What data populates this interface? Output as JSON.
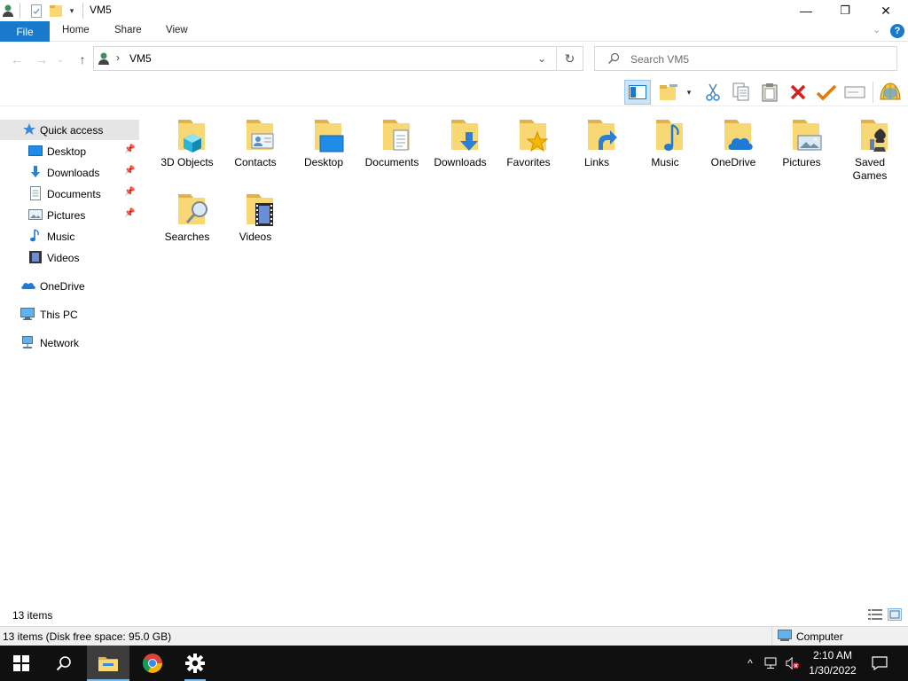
{
  "window": {
    "title": "VM5",
    "controls": {
      "minimize": "—",
      "maximize": "❐",
      "close": "✕"
    }
  },
  "ribbon": {
    "tabs": [
      {
        "label": "File"
      },
      {
        "label": "Home"
      },
      {
        "label": "Share"
      },
      {
        "label": "View"
      }
    ],
    "expand_icon": "chevron-down-icon",
    "help_label": "?"
  },
  "address": {
    "path_separator": "›",
    "location": "VM5",
    "search_placeholder": "Search VM5"
  },
  "toolbar": {
    "icons": [
      "navigation-pane-icon",
      "new-folder-icon",
      "cut-icon",
      "copy-icon",
      "paste-icon",
      "delete-icon",
      "check-icon",
      "rename-icon",
      "shell-icon"
    ]
  },
  "navigation": {
    "quick_access": {
      "label": "Quick access"
    },
    "pinned": [
      {
        "label": "Desktop",
        "icon": "desktop-icon",
        "pinned": true
      },
      {
        "label": "Downloads",
        "icon": "downloads-icon",
        "pinned": true
      },
      {
        "label": "Documents",
        "icon": "documents-icon",
        "pinned": true
      },
      {
        "label": "Pictures",
        "icon": "pictures-icon",
        "pinned": true
      },
      {
        "label": "Music",
        "icon": "music-icon",
        "pinned": false
      },
      {
        "label": "Videos",
        "icon": "videos-icon",
        "pinned": false
      }
    ],
    "roots": [
      {
        "label": "OneDrive",
        "icon": "onedrive-icon"
      },
      {
        "label": "This PC",
        "icon": "this-pc-icon"
      },
      {
        "label": "Network",
        "icon": "network-icon"
      }
    ]
  },
  "folders": [
    {
      "label": "3D Objects",
      "icon": "3d-objects-icon"
    },
    {
      "label": "Contacts",
      "icon": "contacts-icon"
    },
    {
      "label": "Desktop",
      "icon": "desktop-icon"
    },
    {
      "label": "Documents",
      "icon": "documents-icon"
    },
    {
      "label": "Downloads",
      "icon": "downloads-icon"
    },
    {
      "label": "Favorites",
      "icon": "favorites-icon"
    },
    {
      "label": "Links",
      "icon": "links-icon"
    },
    {
      "label": "Music",
      "icon": "music-icon"
    },
    {
      "label": "OneDrive",
      "icon": "onedrive-icon"
    },
    {
      "label": "Pictures",
      "icon": "pictures-icon"
    },
    {
      "label": "Saved Games",
      "icon": "saved-games-icon"
    },
    {
      "label": "Searches",
      "icon": "searches-icon"
    },
    {
      "label": "Videos",
      "icon": "videos-icon"
    }
  ],
  "status": {
    "item_count": "13 items",
    "details": "13 items (Disk free space: 95.0 GB)",
    "location_zone": "Computer"
  },
  "taskbar": {
    "apps": [
      "start-icon",
      "search-icon",
      "file-explorer-icon",
      "chrome-icon",
      "settings-icon"
    ],
    "active_app": "file-explorer-icon",
    "time": "2:10 AM",
    "date": "1/30/2022"
  },
  "colors": {
    "accent": "#1979ca",
    "folder": "#f8d775",
    "folder_dark": "#e0b24a",
    "nav_selected": "#e5e5e5",
    "taskbar": "#101010"
  }
}
